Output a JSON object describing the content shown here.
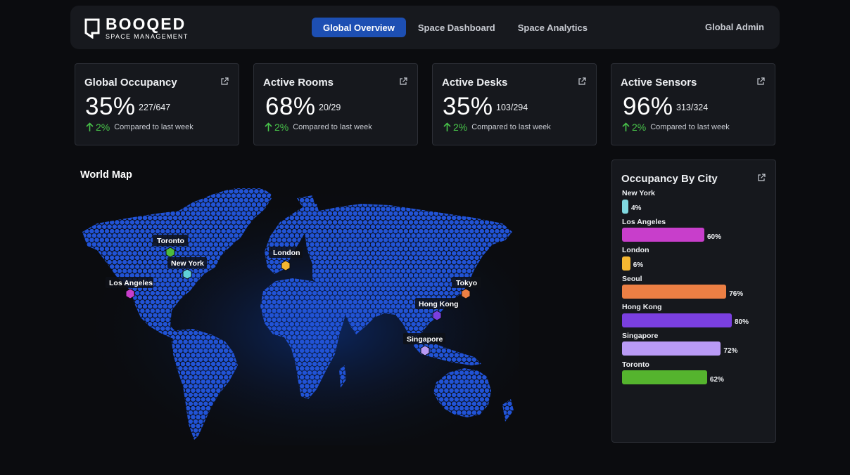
{
  "logo": {
    "name": "BOOQED",
    "subtitle": "SPACE MANAGEMENT"
  },
  "nav": {
    "tabs": [
      {
        "label": "Global Overview",
        "active": true
      },
      {
        "label": "Space Dashboard",
        "active": false
      },
      {
        "label": "Space Analytics",
        "active": false
      }
    ],
    "admin_label": "Global Admin"
  },
  "cards": [
    {
      "title": "Global Occupancy",
      "percent": "35%",
      "fraction": "227/647",
      "trend": "2%",
      "compare": "Compared to last week"
    },
    {
      "title": "Active Rooms",
      "percent": "68%",
      "fraction": "20/29",
      "trend": "2%",
      "compare": "Compared to last week"
    },
    {
      "title": "Active Desks",
      "percent": "35%",
      "fraction": "103/294",
      "trend": "2%",
      "compare": "Compared to last week"
    },
    {
      "title": "Active Sensors",
      "percent": "96%",
      "fraction": "313/324",
      "trend": "2%",
      "compare": "Compared to last week"
    }
  ],
  "map": {
    "title": "World Map",
    "markers": [
      {
        "name": "Toronto",
        "color": "#4dbb3c"
      },
      {
        "name": "New York",
        "color": "#5fd0d8"
      },
      {
        "name": "Los Angeles",
        "color": "#c83ecb"
      },
      {
        "name": "London",
        "color": "#f5b731"
      },
      {
        "name": "Tokyo",
        "color": "#ec7f44"
      },
      {
        "name": "Hong Kong",
        "color": "#7a3fe0"
      },
      {
        "name": "Singapore",
        "color": "#b99af5"
      }
    ]
  },
  "occupancy_by_city": {
    "title": "Occupancy By City",
    "chart_data": {
      "type": "bar",
      "categories": [
        "New York",
        "Los Angeles",
        "London",
        "Seoul",
        "Hong Kong",
        "Singapore",
        "Toronto"
      ],
      "values": [
        4,
        60,
        6,
        76,
        80,
        72,
        62
      ],
      "colors": [
        "#7fd8e0",
        "#c83ecb",
        "#f5b731",
        "#ec7f44",
        "#7a3fe0",
        "#b99af5",
        "#55b42e"
      ],
      "labels": [
        "4%",
        "60%",
        "6%",
        "76%",
        "80%",
        "72%",
        "62%"
      ]
    }
  },
  "colors": {
    "accent": "#1d4fb3",
    "trend_up": "#48c34a",
    "map_dot": "#2153d6"
  }
}
